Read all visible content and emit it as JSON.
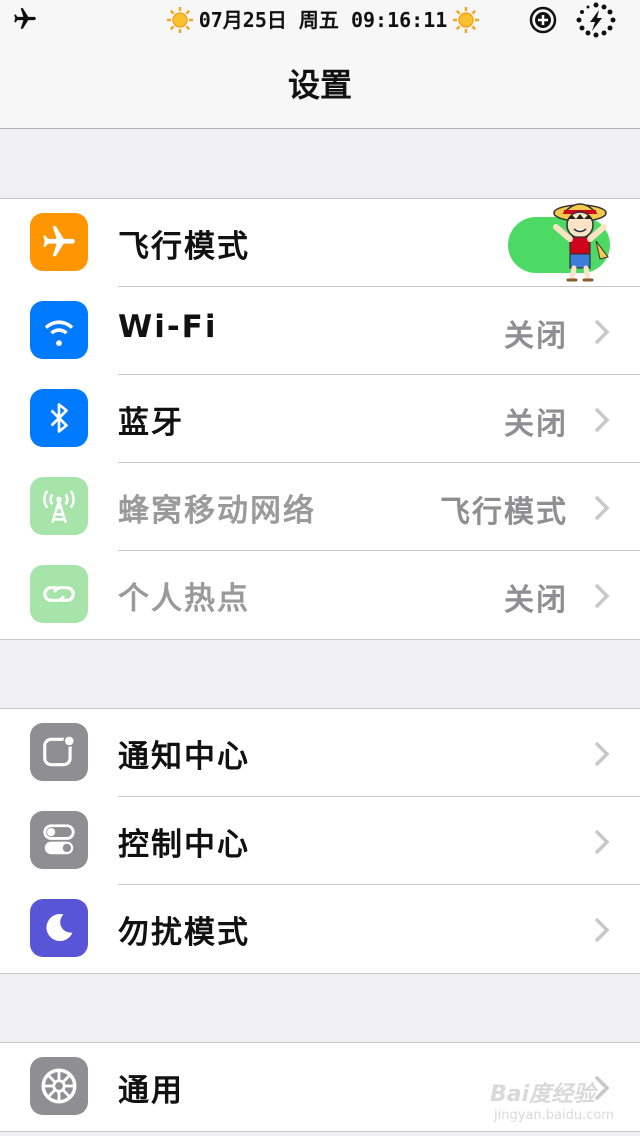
{
  "status_bar": {
    "datetime": "07月25日 周五 09:16:11"
  },
  "nav": {
    "title": "设置"
  },
  "groups": [
    {
      "rows": [
        {
          "label": "飞行模式",
          "icon": "airplane-icon",
          "icon_color": "#ff9500",
          "toggle_on": true
        },
        {
          "label": "Wi-Fi",
          "value": "关闭",
          "icon": "wifi-icon",
          "icon_color": "#007aff"
        },
        {
          "label": "蓝牙",
          "value": "关闭",
          "icon": "bluetooth-icon",
          "icon_color": "#007aff"
        },
        {
          "label": "蜂窝移动网络",
          "value": "飞行模式",
          "icon": "cellular-antenna-icon",
          "icon_color": "#a6e4a9",
          "dimmed": true
        },
        {
          "label": "个人热点",
          "value": "关闭",
          "icon": "hotspot-link-icon",
          "icon_color": "#a6e4a9",
          "dimmed": true
        }
      ]
    },
    {
      "rows": [
        {
          "label": "通知中心",
          "icon": "notification-center-icon",
          "icon_color": "#8e8e93"
        },
        {
          "label": "控制中心",
          "icon": "control-center-icon",
          "icon_color": "#8e8e93"
        },
        {
          "label": "勿扰模式",
          "icon": "moon-icon",
          "icon_color": "#5856d6"
        }
      ]
    },
    {
      "rows": [
        {
          "label": "通用",
          "icon": "gear-icon",
          "icon_color": "#8e8e93"
        }
      ]
    }
  ],
  "watermark": {
    "brand": "Bai度经验",
    "url": "jingyan.baidu.com"
  }
}
